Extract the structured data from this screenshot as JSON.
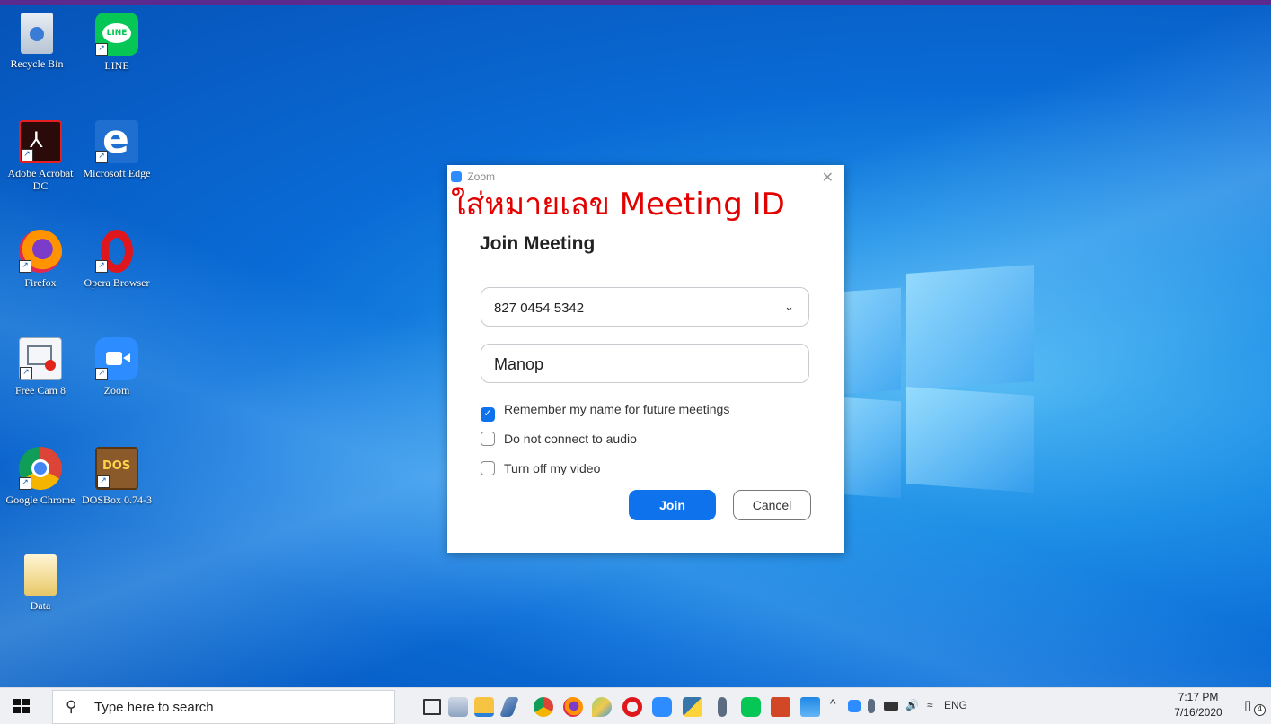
{
  "desktop": {
    "icons": [
      {
        "label": "Recycle Bin",
        "icon": "recycle-bin-icon"
      },
      {
        "label": "LINE",
        "icon": "line-app-icon",
        "badge": "LINE"
      },
      {
        "label": "Adobe Acrobat DC",
        "icon": "adobe-acrobat-icon"
      },
      {
        "label": "Microsoft Edge",
        "icon": "edge-icon",
        "glyph": "e"
      },
      {
        "label": "Firefox",
        "icon": "firefox-icon"
      },
      {
        "label": "Opera Browser",
        "icon": "opera-icon",
        "glyph": "O"
      },
      {
        "label": "Free Cam 8",
        "icon": "free-cam-icon"
      },
      {
        "label": "Zoom",
        "icon": "zoom-icon"
      },
      {
        "label": "Google Chrome",
        "icon": "chrome-icon"
      },
      {
        "label": "DOSBox 0.74-3",
        "icon": "dosbox-icon",
        "glyph": "DOS"
      },
      {
        "label": "Data",
        "icon": "folder-icon"
      }
    ]
  },
  "overlay_text": "ใส่หมายเลข Meeting ID",
  "dialog": {
    "window_title": "Zoom",
    "close_glyph": "✕",
    "heading": "Join Meeting",
    "meeting_id_value": "827 0454 5342",
    "name_value": "Manop",
    "checkboxes": [
      {
        "label": "Remember my name for future meetings",
        "checked": true
      },
      {
        "label": "Do not connect to audio",
        "checked": false
      },
      {
        "label": "Turn off my video",
        "checked": false
      }
    ],
    "join_label": "Join",
    "cancel_label": "Cancel",
    "accent_color": "#0e72ed"
  },
  "taskbar": {
    "search_placeholder": "Type here to search",
    "pinned": [
      "task-view-icon",
      "picture-viewer-icon",
      "file-explorer-icon",
      "pen-icon",
      "chrome-icon",
      "firefox-icon",
      "paint-icon",
      "opera-icon",
      "zoom-icon",
      "python-icon",
      "microphone-icon",
      "line-app-icon",
      "powerpoint-icon",
      "photos-icon"
    ],
    "tray": {
      "language": "ENG",
      "time": "7:17 PM",
      "date": "7/16/2020",
      "notification_count": "4"
    }
  }
}
